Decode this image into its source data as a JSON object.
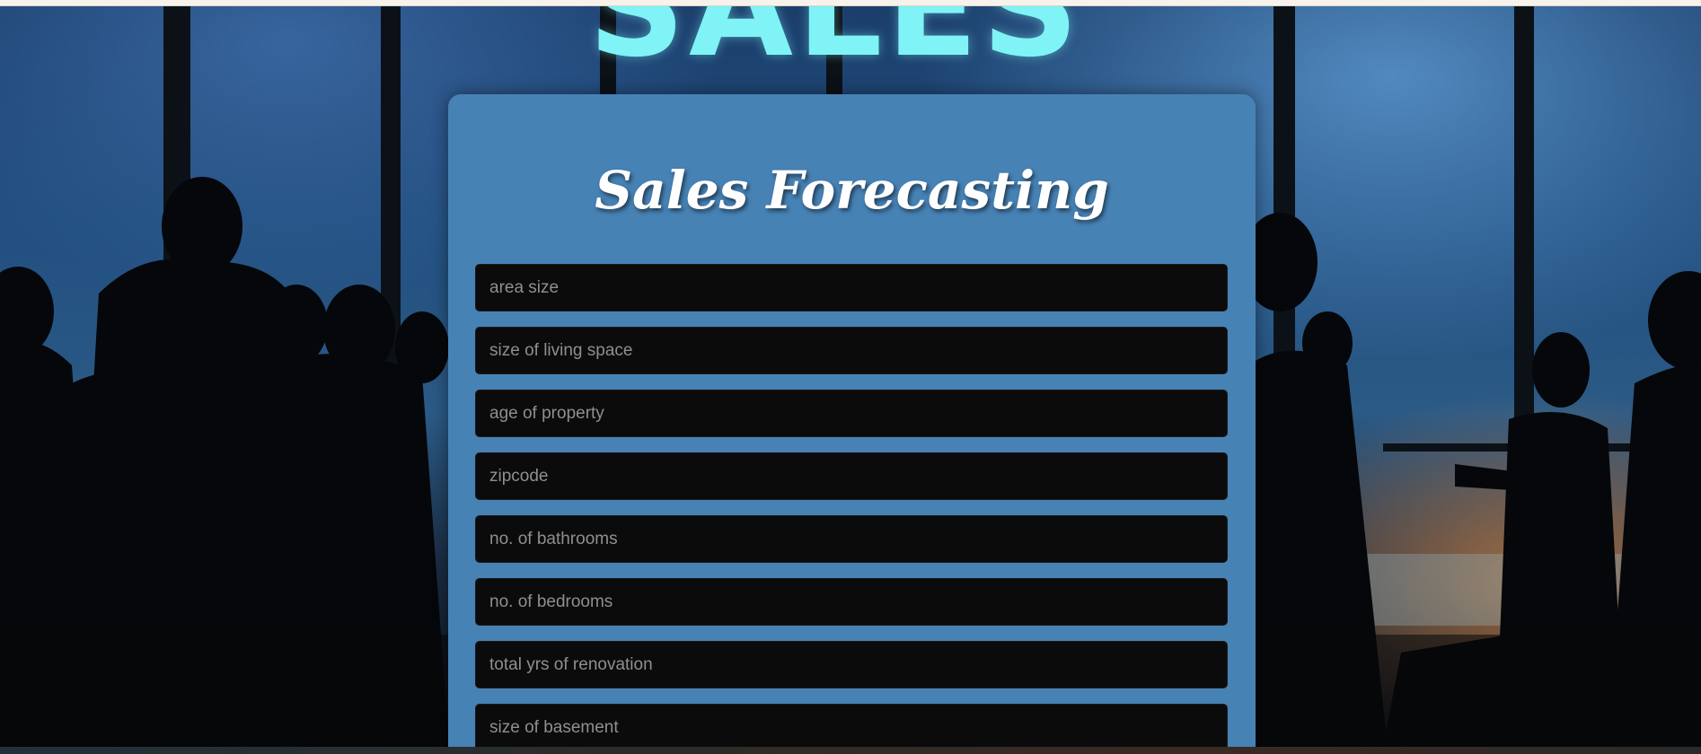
{
  "hero": {
    "banner_text": "SALES"
  },
  "form": {
    "title": "Sales Forecasting",
    "fields": [
      {
        "placeholder": "area size",
        "value": ""
      },
      {
        "placeholder": "size of living space",
        "value": ""
      },
      {
        "placeholder": "age of property",
        "value": ""
      },
      {
        "placeholder": "zipcode",
        "value": ""
      },
      {
        "placeholder": "no. of bathrooms",
        "value": ""
      },
      {
        "placeholder": "no. of bedrooms",
        "value": ""
      },
      {
        "placeholder": "total yrs of renovation",
        "value": ""
      },
      {
        "placeholder": "size of basement",
        "value": ""
      }
    ]
  }
}
